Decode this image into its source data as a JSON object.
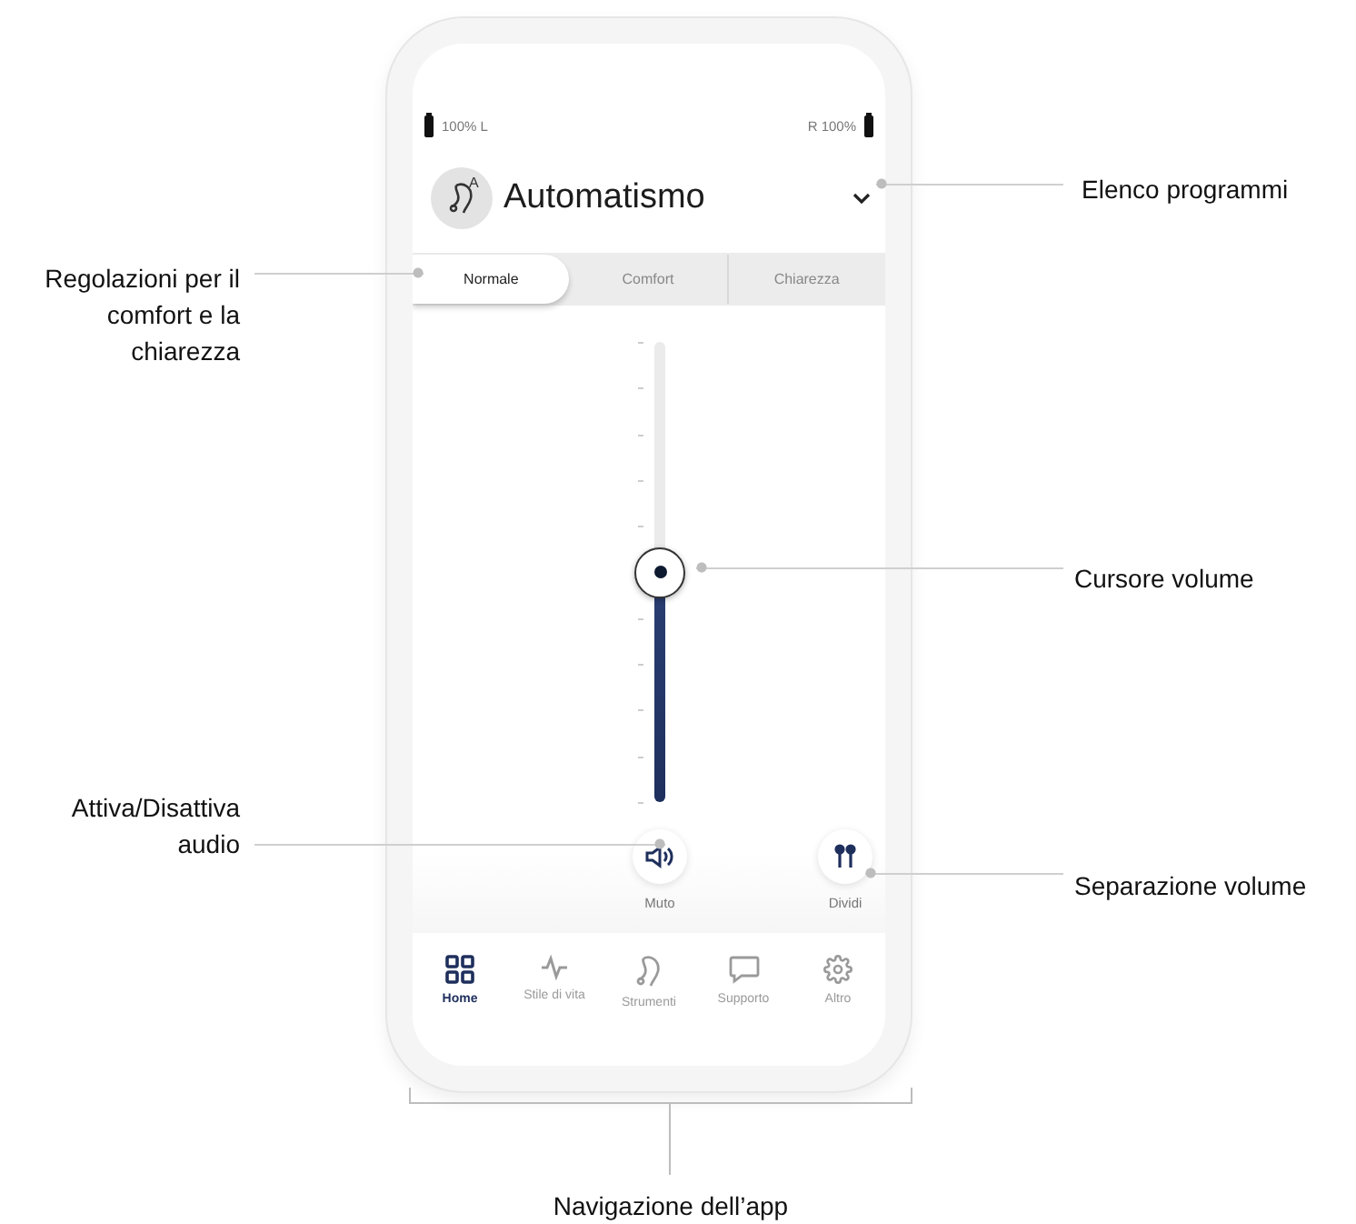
{
  "status": {
    "left_battery": "100% L",
    "right_battery": "R 100%"
  },
  "program": {
    "name": "Automatismo",
    "badge": "A"
  },
  "tabs": [
    {
      "label": "Normale",
      "selected": true
    },
    {
      "label": "Comfort",
      "selected": false
    },
    {
      "label": "Chiarezza",
      "selected": false
    }
  ],
  "volume": {
    "level": 0.5
  },
  "actions": [
    {
      "kind": "mute",
      "label": "Muto"
    },
    {
      "kind": "split",
      "label": "Dividi"
    }
  ],
  "nav": [
    {
      "kind": "home",
      "label": "Home",
      "selected": true
    },
    {
      "kind": "lifestyle",
      "label": "Stile di vita",
      "selected": false
    },
    {
      "kind": "devices",
      "label": "Strumenti",
      "selected": false
    },
    {
      "kind": "support",
      "label": "Supporto",
      "selected": false
    },
    {
      "kind": "more",
      "label": "Altro",
      "selected": false
    }
  ],
  "callouts": [
    {
      "kind": "program_list",
      "text": "Elenco programmi"
    },
    {
      "kind": "comfort_clarity",
      "text": "Regolazioni per il comfort e la chiarezza"
    },
    {
      "kind": "volume_slider",
      "text": "Cursore volume"
    },
    {
      "kind": "audio_toggle",
      "text": "Attiva/Disattiva audio"
    },
    {
      "kind": "volume_split",
      "text": "Separazione volume"
    },
    {
      "kind": "app_navigation",
      "text": "Navigazione dell’app"
    }
  ]
}
